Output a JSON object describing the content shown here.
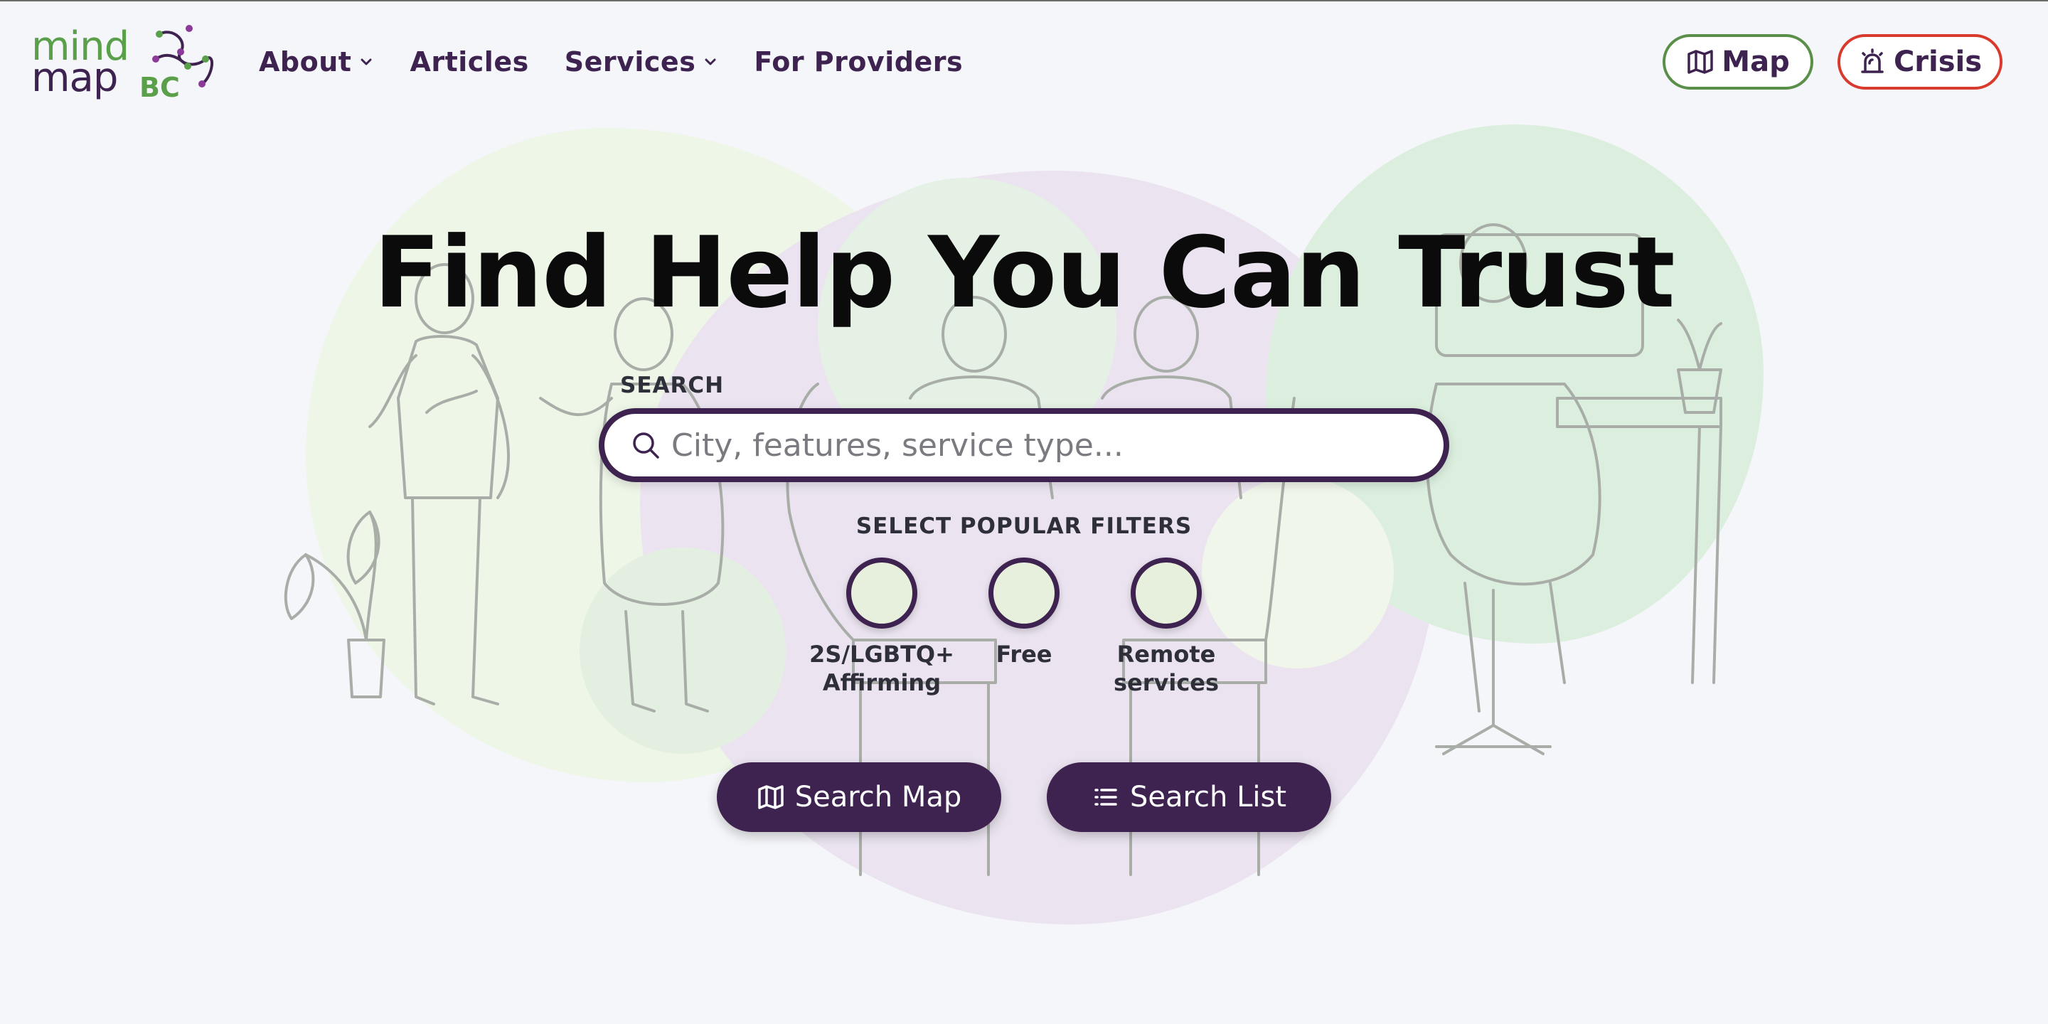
{
  "logo": {
    "line1": "mind",
    "line2": "map",
    "region": "BC"
  },
  "nav": {
    "items": [
      {
        "label": "About",
        "has_dropdown": true
      },
      {
        "label": "Articles",
        "has_dropdown": false
      },
      {
        "label": "Services",
        "has_dropdown": true
      },
      {
        "label": "For Providers",
        "has_dropdown": false
      }
    ]
  },
  "header_buttons": {
    "map": {
      "label": "Map",
      "icon": "map-icon",
      "border_color": "#5a8f4a"
    },
    "crisis": {
      "label": "Crisis",
      "icon": "alarm-icon",
      "border_color": "#d93a2e"
    }
  },
  "hero": {
    "title": "Find Help You Can Trust"
  },
  "search": {
    "label": "SEARCH",
    "placeholder": "City, features, service type...",
    "value": ""
  },
  "filters": {
    "label": "SELECT POPULAR FILTERS",
    "items": [
      {
        "label": "2S/LGBTQ+ Affirming",
        "selected": false
      },
      {
        "label": "Free",
        "selected": false
      },
      {
        "label": "Remote services",
        "selected": false
      }
    ]
  },
  "actions": {
    "search_map": "Search Map",
    "search_list": "Search List"
  },
  "colors": {
    "brand_purple": "#3e2350",
    "brand_green": "#5aa04a",
    "background": "#f5f6f9",
    "crisis_red": "#d93a2e"
  }
}
